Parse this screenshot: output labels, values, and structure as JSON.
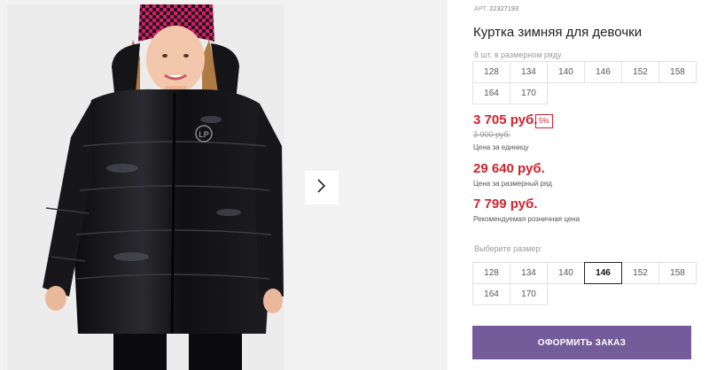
{
  "product": {
    "article_label": "АРТ.",
    "article_number": "22327193",
    "title": "Куртка зимняя для девочки",
    "pack_caption": "8 шт. в размерном ряду",
    "pack_sizes": [
      "128",
      "134",
      "140",
      "146",
      "152",
      "158",
      "164",
      "170"
    ]
  },
  "pricing": {
    "unit_price": "3 705 руб.",
    "discount_badge": "5%",
    "old_price": "3 900 руб.",
    "unit_price_note": "Цена за единицу",
    "pack_price": "29 640 руб.",
    "pack_price_note": "Цена за размерный ряд",
    "retail_price": "7 799 руб.",
    "retail_price_note": "Рекомендуемая розничная цена"
  },
  "size_picker": {
    "caption": "Выберите размер:",
    "sizes": [
      "128",
      "134",
      "140",
      "146",
      "152",
      "158",
      "164",
      "170"
    ],
    "selected": "146"
  },
  "order_button_label": "ОФОРМИТЬ ЗАКАЗ",
  "gallery": {
    "next_icon": "chevron-right-icon",
    "jacket_logo": "LP"
  },
  "colors": {
    "price_red": "#d2222d",
    "button_purple": "#745c9a",
    "jacket_black": "#141417",
    "hat_pink": "#e0186a"
  }
}
